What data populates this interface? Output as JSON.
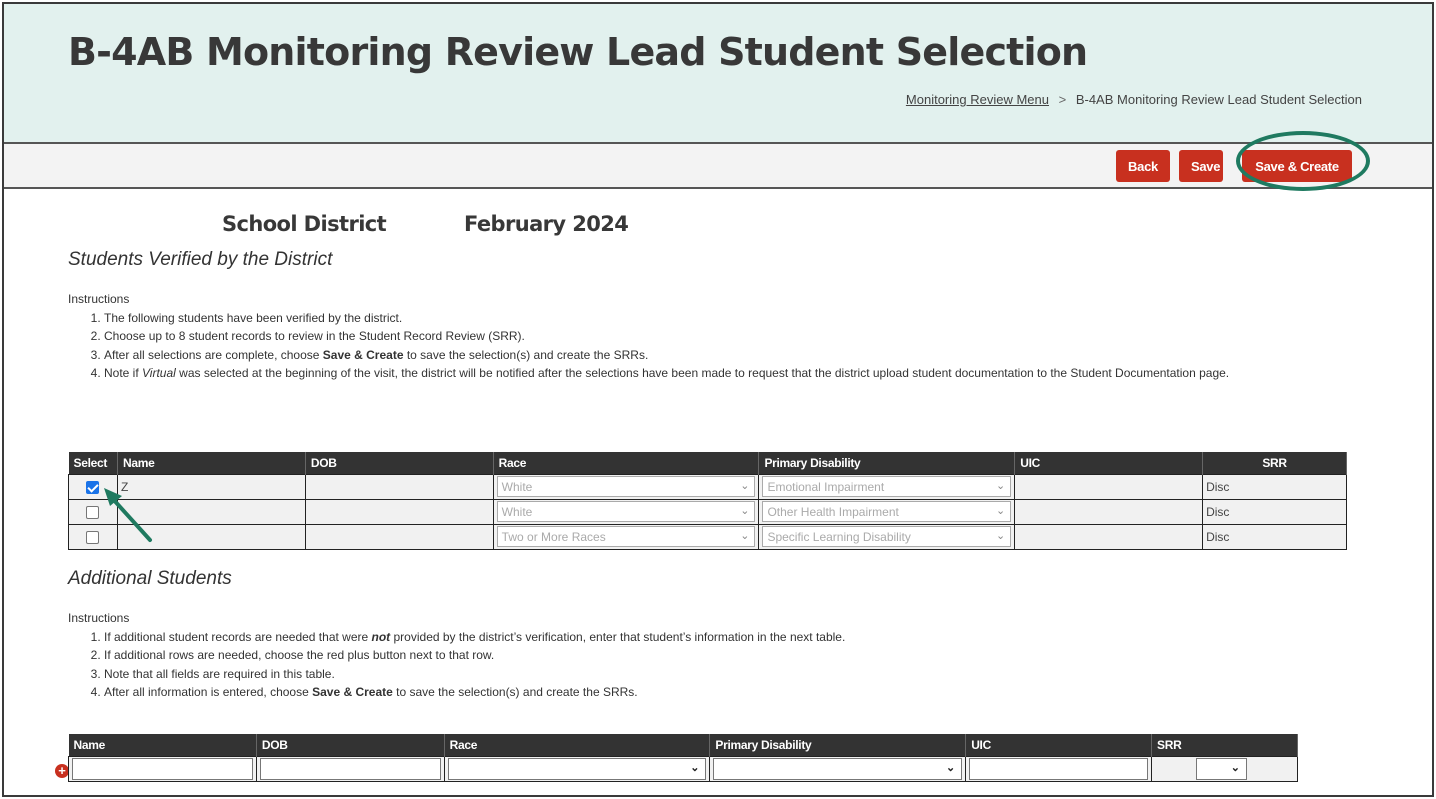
{
  "header": {
    "title": "B-4AB Monitoring Review Lead Student Selection",
    "breadcrumb": {
      "parent_link": "Monitoring Review Menu",
      "separator": ">",
      "current": "B-4AB Monitoring Review Lead Student Selection"
    }
  },
  "toolbar": {
    "back_label": "Back",
    "save_label": "Save",
    "save_create_label": "Save & Create",
    "highlight_color": "#1f7a60",
    "button_color": "#c8301f"
  },
  "meta": {
    "district": "School District",
    "period": "February 2024"
  },
  "verified": {
    "heading": "Students Verified by the District",
    "instructions_label": "Instructions",
    "instructions": {
      "i1": "The following students have been verified by the district.",
      "i2": "Choose up to 8 student records to review in the Student Record Review (SRR).",
      "i3_pre": "After all selections are complete, choose ",
      "i3_bold": "Save & Create",
      "i3_post": " to save the selection(s) and create the SRRs.",
      "i4_pre": "Note if ",
      "i4_italic": "Virtual",
      "i4_post": " was selected at the beginning of the visit, the district will be notified after the selections have been made to request that the district upload student documentation to the Student Documentation page."
    },
    "columns": {
      "select": "Select",
      "name": "Name",
      "dob": "DOB",
      "race": "Race",
      "disability": "Primary Disability",
      "uic": "UIC",
      "srr": "SRR"
    },
    "rows": [
      {
        "selected": true,
        "name": "Z",
        "dob": "",
        "race": "White",
        "disability": "Emotional Impairment",
        "uic": "",
        "srr": "Disc"
      },
      {
        "selected": false,
        "name": "",
        "dob": "",
        "race": "White",
        "disability": "Other Health Impairment",
        "uic": "",
        "srr": "Disc"
      },
      {
        "selected": false,
        "name": "",
        "dob": "",
        "race": "Two or More Races",
        "disability": "Specific Learning Disability",
        "uic": "",
        "srr": "Disc"
      }
    ]
  },
  "additional": {
    "heading": "Additional Students",
    "instructions_label": "Instructions",
    "instructions": {
      "i1_pre": "If additional student records are needed that were ",
      "i1_em": "not",
      "i1_post": " provided by the district’s verification, enter that student’s information in the next table.",
      "i2": "If additional rows are needed, choose the red plus button next to that row.",
      "i3": "Note that all fields are required in this table.",
      "i4_pre": "After all information is entered, choose ",
      "i4_bold": "Save & Create",
      "i4_post": " to save the selection(s) and create the SRRs."
    },
    "columns": {
      "name": "Name",
      "dob": "DOB",
      "race": "Race",
      "disability": "Primary Disability",
      "uic": "UIC",
      "srr": "SRR"
    },
    "row": {
      "name": "",
      "dob": "",
      "race": "",
      "disability": "",
      "uic": "",
      "srr": ""
    },
    "add_icon": "plus-circle-icon"
  }
}
